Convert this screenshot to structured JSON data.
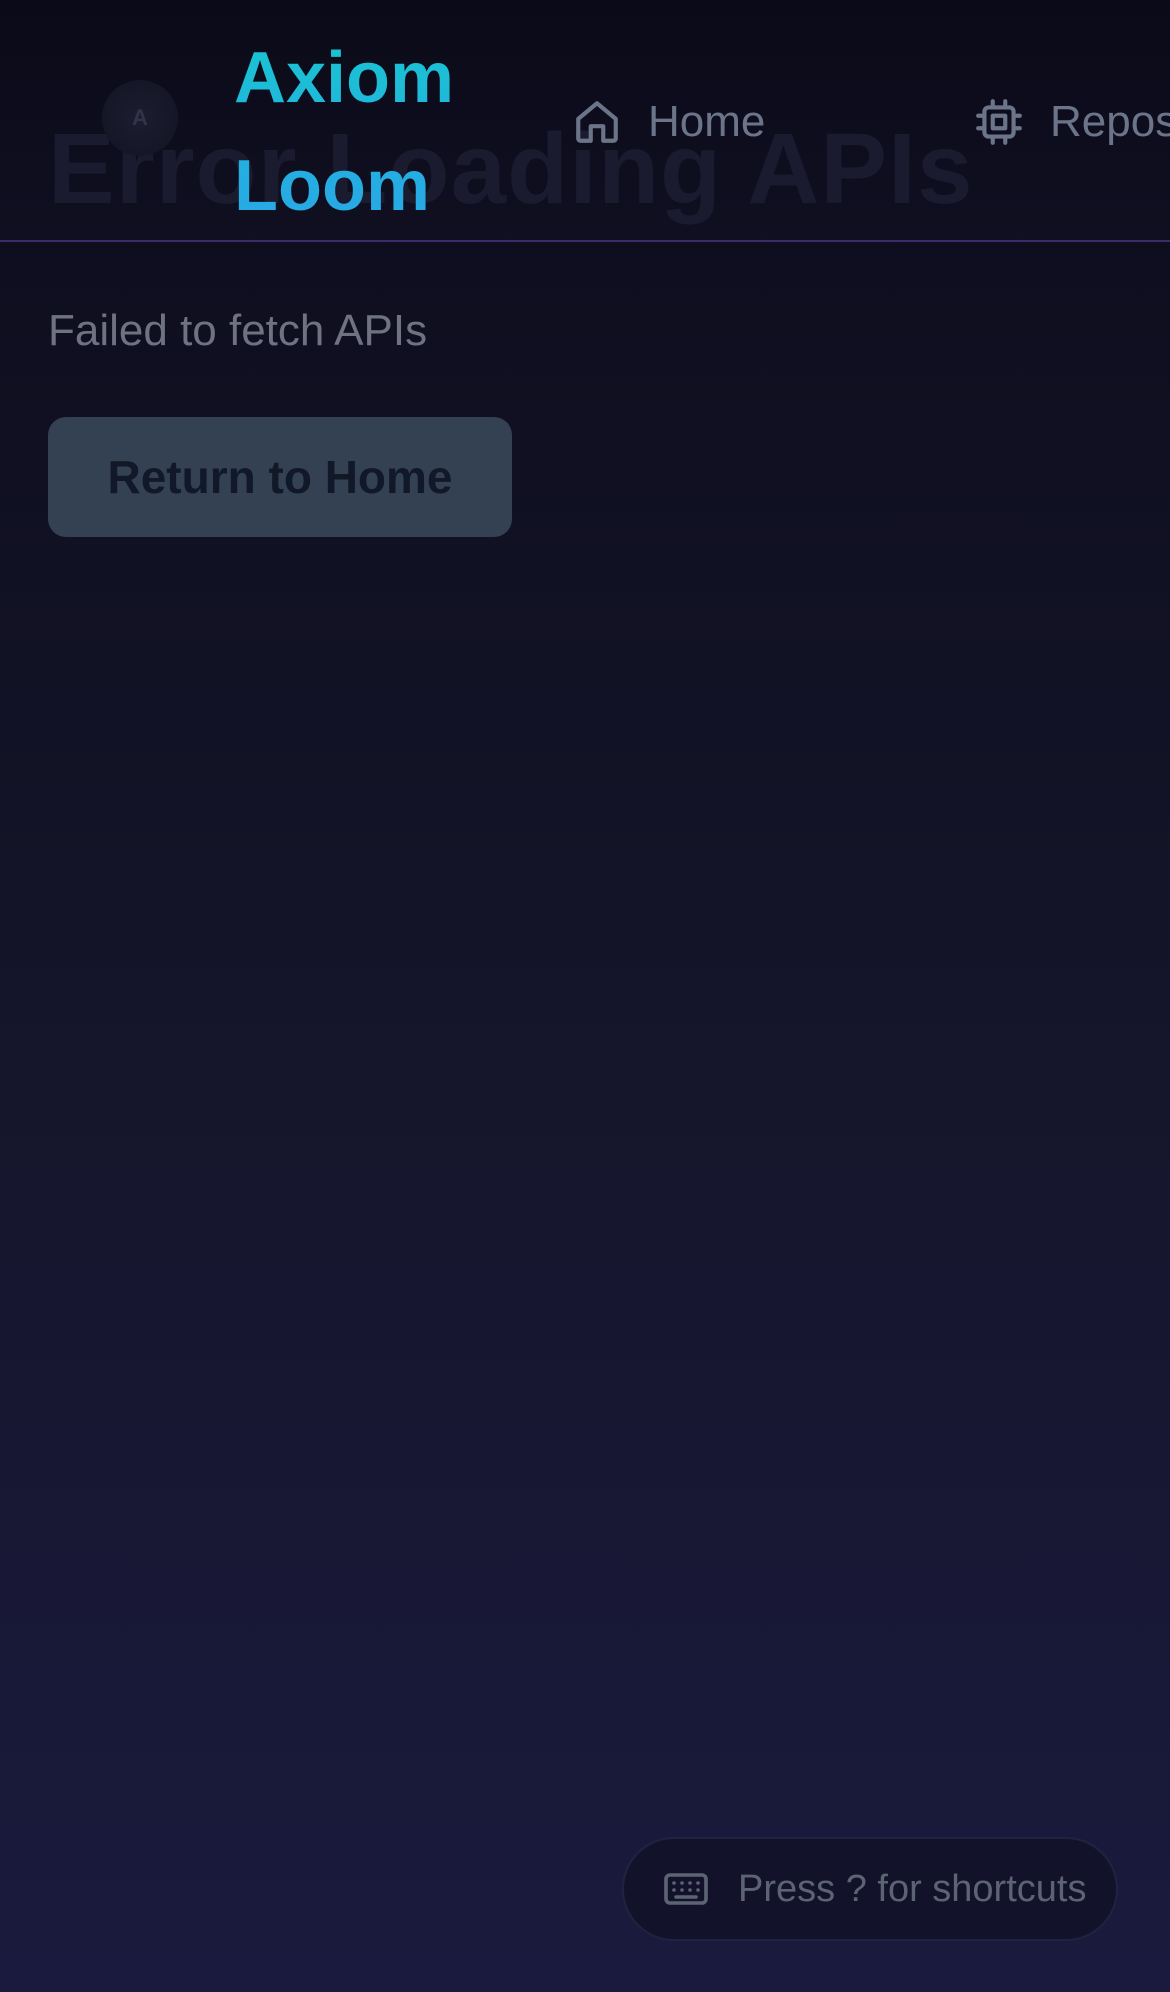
{
  "header": {
    "background_heading": "Error Loading APIs",
    "logo_initial": "A",
    "brand_line1": "Axiom",
    "brand_line2": "Loom",
    "nav": [
      {
        "label": "Home",
        "icon": "home-icon"
      },
      {
        "label": "Repositories",
        "icon": "cpu-icon"
      }
    ]
  },
  "main": {
    "error_message": "Failed to fetch APIs",
    "return_button_label": "Return to Home"
  },
  "footer": {
    "shortcuts_hint": "Press ? for shortcuts",
    "shortcuts_icon": "keyboard-icon"
  },
  "colors": {
    "background_top": "#0c0c1c",
    "background_bottom": "#1a1a3e",
    "brand_gradient_start": "#19c7cf",
    "brand_gradient_end": "#2ba6e6",
    "header_divider": "#3b2d6b",
    "button_bg": "#344153"
  }
}
